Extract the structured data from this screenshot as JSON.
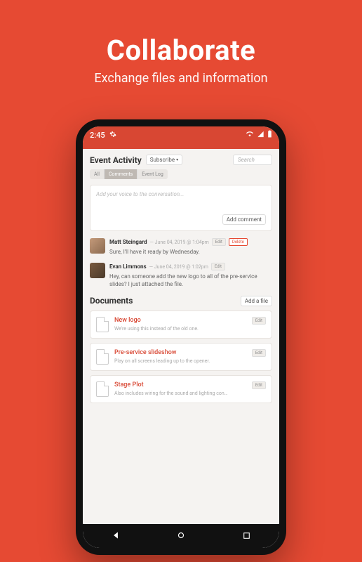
{
  "hero": {
    "title": "Collaborate",
    "subtitle": "Exchange files and information"
  },
  "status": {
    "time": "2:45"
  },
  "activity": {
    "title": "Event Activity",
    "subscribe_label": "Subscribe",
    "search_placeholder": "Search",
    "tabs": {
      "all": "All",
      "comments": "Comments",
      "event_log": "Event Log"
    },
    "compose_placeholder": "Add your voice to the conversation...",
    "add_comment_label": "Add comment"
  },
  "comments": [
    {
      "author": "Matt Steingard",
      "meta": "— June 04, 2019 @ 1:04pm",
      "text": "Sure, I'll have it ready by Wednesday.",
      "edit_label": "Edit",
      "delete_label": "Delete"
    },
    {
      "author": "Evan Limmons",
      "meta": "— June 04, 2019 @ 1:02pm",
      "text": "Hey, can someone add the new logo to all of the pre-service slides? I just attached the file.",
      "edit_label": "Edit"
    }
  ],
  "documents": {
    "title": "Documents",
    "add_label": "Add a file",
    "items": [
      {
        "title": "New logo",
        "desc": "We're using this instead of the old one.",
        "edit_label": "Edit"
      },
      {
        "title": "Pre-service slideshow",
        "desc": "Play on all screens leading up to the opener.",
        "edit_label": "Edit"
      },
      {
        "title": "Stage Plot",
        "desc": "Also includes wiring for the sound and lighting con…",
        "edit_label": "Edit"
      }
    ]
  }
}
